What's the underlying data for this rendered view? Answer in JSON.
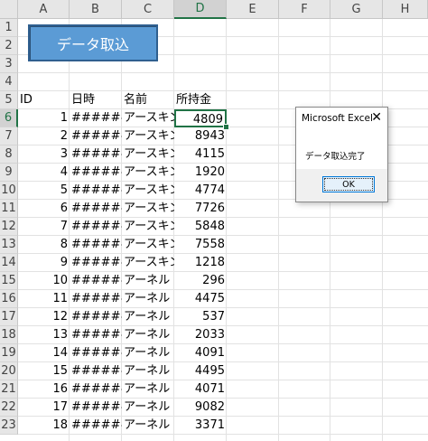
{
  "columns": [
    "A",
    "B",
    "C",
    "D",
    "E",
    "F",
    "G",
    "H"
  ],
  "rows": [
    "1",
    "2",
    "3",
    "4",
    "5",
    "6",
    "7",
    "8",
    "9",
    "10",
    "11",
    "12",
    "13",
    "14",
    "15",
    "16",
    "17",
    "18",
    "19",
    "20",
    "21",
    "22",
    "23"
  ],
  "button": {
    "label": "データ取込"
  },
  "headers": {
    "id": "ID",
    "date": "日時",
    "name": "名前",
    "money": "所持金"
  },
  "data": [
    {
      "id": "1",
      "date": "#######",
      "name": "アースキン",
      "money": "4809"
    },
    {
      "id": "2",
      "date": "#######",
      "name": "アースキン",
      "money": "8943"
    },
    {
      "id": "3",
      "date": "#######",
      "name": "アースキン",
      "money": "4115"
    },
    {
      "id": "4",
      "date": "#######",
      "name": "アースキン",
      "money": "1920"
    },
    {
      "id": "5",
      "date": "#######",
      "name": "アースキン",
      "money": "4774"
    },
    {
      "id": "6",
      "date": "#######",
      "name": "アースキン",
      "money": "7726"
    },
    {
      "id": "7",
      "date": "#######",
      "name": "アースキン",
      "money": "5848"
    },
    {
      "id": "8",
      "date": "#######",
      "name": "アースキン",
      "money": "7558"
    },
    {
      "id": "9",
      "date": "#######",
      "name": "アースキン",
      "money": "1218"
    },
    {
      "id": "10",
      "date": "#######",
      "name": "アーネル",
      "money": "296"
    },
    {
      "id": "11",
      "date": "#######",
      "name": "アーネル",
      "money": "4475"
    },
    {
      "id": "12",
      "date": "#######",
      "name": "アーネル",
      "money": "537"
    },
    {
      "id": "13",
      "date": "#######",
      "name": "アーネル",
      "money": "2033"
    },
    {
      "id": "14",
      "date": "#######",
      "name": "アーネル",
      "money": "4091"
    },
    {
      "id": "15",
      "date": "#######",
      "name": "アーネル",
      "money": "4495"
    },
    {
      "id": "16",
      "date": "#######",
      "name": "アーネル",
      "money": "4071"
    },
    {
      "id": "17",
      "date": "#######",
      "name": "アーネル",
      "money": "9082"
    },
    {
      "id": "18",
      "date": "#######",
      "name": "アーネル",
      "money": "3371"
    }
  ],
  "dialog": {
    "title": "Microsoft Excel",
    "close_glyph": "✕",
    "message": "データ取込完了",
    "ok_label": "OK"
  },
  "colors": {
    "accent": "#217346",
    "button_fill": "#5b9bd5"
  }
}
